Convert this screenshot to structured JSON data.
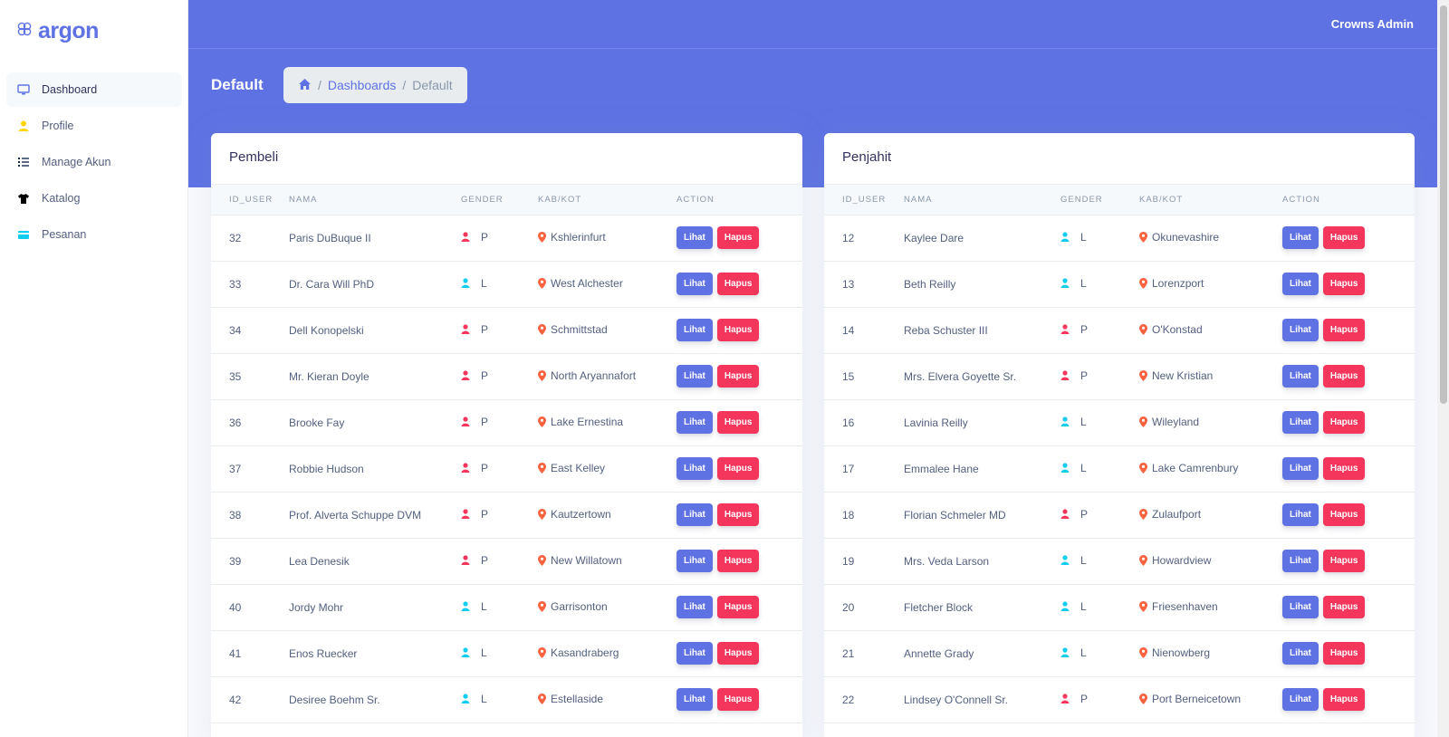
{
  "brand": {
    "name": "argon"
  },
  "sidebar": {
    "items": [
      {
        "label": "Dashboard",
        "icon": "monitor-icon",
        "color": "#5e72e4",
        "active": true
      },
      {
        "label": "Profile",
        "icon": "user-icon",
        "color": "#ffd600",
        "active": false
      },
      {
        "label": "Manage Akun",
        "icon": "list-icon",
        "color": "#172b4d",
        "active": false
      },
      {
        "label": "Katalog",
        "icon": "tshirt-icon",
        "color": "#000000",
        "active": false
      },
      {
        "label": "Pesanan",
        "icon": "card-icon",
        "color": "#11cdef",
        "active": false
      }
    ]
  },
  "header": {
    "user_name": "Crowns Admin",
    "page_title": "Default",
    "breadcrumb": {
      "home_icon": "home-icon",
      "link": "Dashboards",
      "current": "Default",
      "separator": "/"
    }
  },
  "colors": {
    "primary": "#5e72e4",
    "danger": "#f5365c",
    "info": "#11cdef",
    "pin": "#fb6340"
  },
  "tables": [
    {
      "title": "Pembeli",
      "columns": [
        "ID_USER",
        "NAMA",
        "GENDER",
        "KAB/KOT",
        "ACTION"
      ],
      "actions": {
        "view": "Lihat",
        "delete": "Hapus"
      },
      "rows": [
        {
          "id": "32",
          "name": "Paris DuBuque II",
          "gender": "P",
          "city": "Kshlerinfurt"
        },
        {
          "id": "33",
          "name": "Dr. Cara Will PhD",
          "gender": "L",
          "city": "West Alchester"
        },
        {
          "id": "34",
          "name": "Dell Konopelski",
          "gender": "P",
          "city": "Schmittstad"
        },
        {
          "id": "35",
          "name": "Mr. Kieran Doyle",
          "gender": "P",
          "city": "North Aryannafort"
        },
        {
          "id": "36",
          "name": "Brooke Fay",
          "gender": "P",
          "city": "Lake Ernestina"
        },
        {
          "id": "37",
          "name": "Robbie Hudson",
          "gender": "P",
          "city": "East Kelley"
        },
        {
          "id": "38",
          "name": "Prof. Alverta Schuppe DVM",
          "gender": "P",
          "city": "Kautzertown"
        },
        {
          "id": "39",
          "name": "Lea Denesik",
          "gender": "P",
          "city": "New Willatown"
        },
        {
          "id": "40",
          "name": "Jordy Mohr",
          "gender": "L",
          "city": "Garrisonton"
        },
        {
          "id": "41",
          "name": "Enos Ruecker",
          "gender": "L",
          "city": "Kasandraberg"
        },
        {
          "id": "42",
          "name": "Desiree Boehm Sr.",
          "gender": "L",
          "city": "Estellaside"
        }
      ]
    },
    {
      "title": "Penjahit",
      "columns": [
        "ID_USER",
        "NAMA",
        "GENDER",
        "KAB/KOT",
        "ACTION"
      ],
      "actions": {
        "view": "Lihat",
        "delete": "Hapus"
      },
      "rows": [
        {
          "id": "12",
          "name": "Kaylee Dare",
          "gender": "L",
          "city": "Okunevashire"
        },
        {
          "id": "13",
          "name": "Beth Reilly",
          "gender": "L",
          "city": "Lorenzport"
        },
        {
          "id": "14",
          "name": "Reba Schuster III",
          "gender": "P",
          "city": "O'Konstad"
        },
        {
          "id": "15",
          "name": "Mrs. Elvera Goyette Sr.",
          "gender": "P",
          "city": "New Kristian"
        },
        {
          "id": "16",
          "name": "Lavinia Reilly",
          "gender": "L",
          "city": "Wileyland"
        },
        {
          "id": "17",
          "name": "Emmalee Hane",
          "gender": "L",
          "city": "Lake Camrenbury"
        },
        {
          "id": "18",
          "name": "Florian Schmeler MD",
          "gender": "P",
          "city": "Zulaufport"
        },
        {
          "id": "19",
          "name": "Mrs. Veda Larson",
          "gender": "L",
          "city": "Howardview"
        },
        {
          "id": "20",
          "name": "Fletcher Block",
          "gender": "L",
          "city": "Friesenhaven"
        },
        {
          "id": "21",
          "name": "Annette Grady",
          "gender": "L",
          "city": "Nienowberg"
        },
        {
          "id": "22",
          "name": "Lindsey O'Connell Sr.",
          "gender": "P",
          "city": "Port Berneicetown"
        }
      ]
    }
  ]
}
